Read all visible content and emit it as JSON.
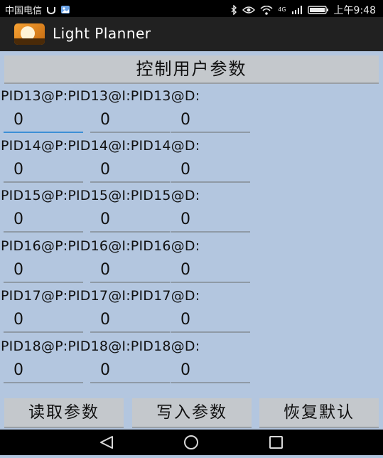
{
  "status_bar": {
    "carrier": "中国电信",
    "lte": "4G",
    "time": "上午9:48"
  },
  "action_bar": {
    "title": "Light Planner"
  },
  "main": {
    "header_button": "控制用户参数",
    "rows": [
      {
        "label": "PID13@P:PID13@I:PID13@D:",
        "p": "0",
        "i": "0",
        "d": "0"
      },
      {
        "label": "PID14@P:PID14@I:PID14@D:",
        "p": "0",
        "i": "0",
        "d": "0"
      },
      {
        "label": "PID15@P:PID15@I:PID15@D:",
        "p": "0",
        "i": "0",
        "d": "0"
      },
      {
        "label": "PID16@P:PID16@I:PID16@D:",
        "p": "0",
        "i": "0",
        "d": "0"
      },
      {
        "label": "PID17@P:PID17@I:PID17@D:",
        "p": "0",
        "i": "0",
        "d": "0"
      },
      {
        "label": "PID18@P:PID18@I:PID18@D:",
        "p": "0",
        "i": "0",
        "d": "0"
      }
    ],
    "read_button": "读取参数",
    "write_button": "写入参数",
    "restore_button": "恢复默认"
  },
  "icons": {
    "status_left": [
      "usb-icon",
      "image-icon"
    ],
    "status_right": [
      "bluetooth-icon",
      "eye-icon",
      "wifi-icon",
      "signal-icon",
      "battery-icon"
    ],
    "nav": [
      "back-icon",
      "home-icon",
      "recents-icon"
    ]
  },
  "colors": {
    "background": "#b3c6df",
    "focus_underline": "#3c8fd6",
    "button": "#c4c8cc"
  }
}
